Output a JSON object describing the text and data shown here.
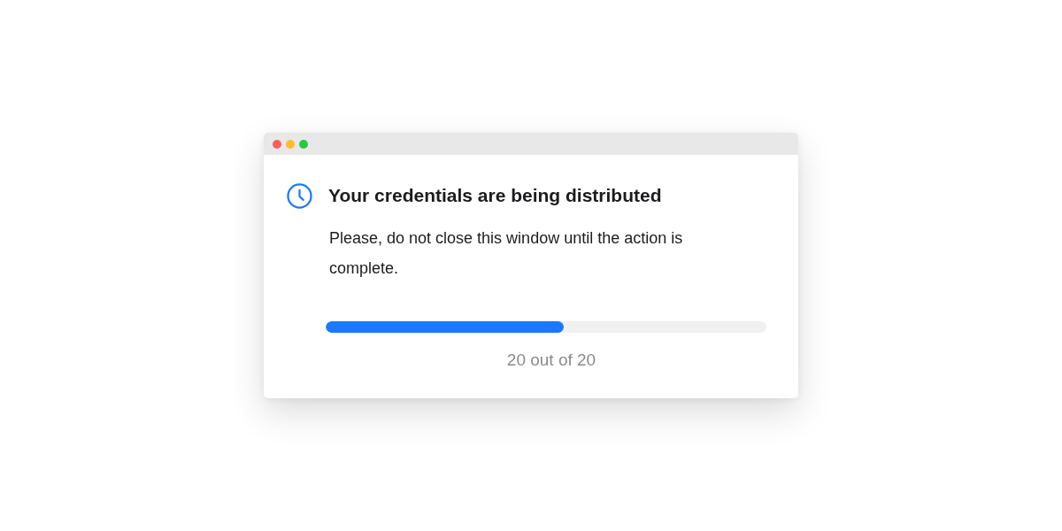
{
  "window": {
    "controls": [
      {
        "color": "#fe5f57"
      },
      {
        "color": "#febc2e"
      },
      {
        "color": "#28c840"
      }
    ]
  },
  "dialog": {
    "title": "Your credentials are being distributed",
    "message": "Please, do not close this window until the action is complete.",
    "progress": {
      "level": 0.54,
      "caption": "20 out of 20"
    }
  }
}
